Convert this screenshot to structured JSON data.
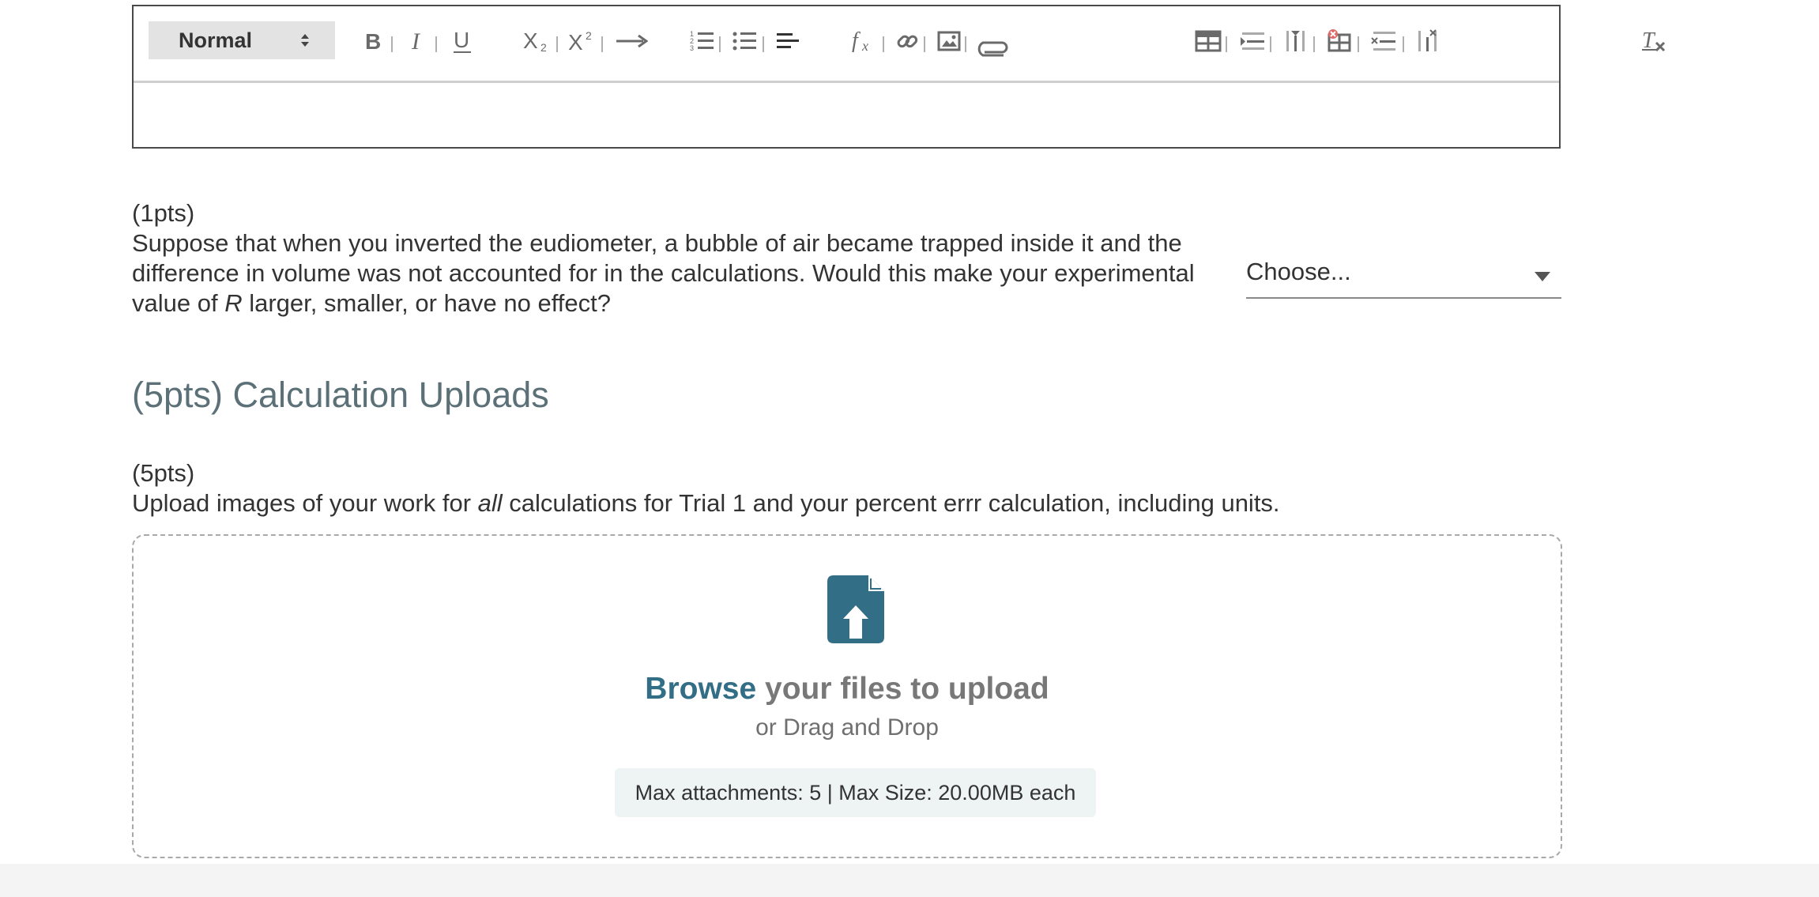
{
  "editor": {
    "style_select": {
      "value": "Normal"
    },
    "toolbar": [
      {
        "name": "bold-icon",
        "glyph": "B"
      },
      {
        "name": "italic-icon",
        "glyph": "I"
      },
      {
        "name": "underline-icon",
        "glyph": "U"
      },
      {
        "name": "subscript-icon",
        "glyph": "X2"
      },
      {
        "name": "superscript-icon",
        "glyph": "X2"
      },
      {
        "name": "arrow-icon",
        "glyph": "→"
      },
      {
        "name": "numbered-list-icon"
      },
      {
        "name": "bulleted-list-icon"
      },
      {
        "name": "align-icon"
      },
      {
        "name": "formula-icon",
        "glyph": "fx"
      },
      {
        "name": "link-icon"
      },
      {
        "name": "image-icon"
      },
      {
        "name": "attachment-icon"
      },
      {
        "name": "table-icon"
      },
      {
        "name": "insert-row-icon"
      },
      {
        "name": "insert-column-icon"
      },
      {
        "name": "delete-table-icon"
      },
      {
        "name": "delete-row-icon"
      },
      {
        "name": "delete-column-icon"
      },
      {
        "name": "clear-formatting-icon",
        "glyph": "Tx"
      }
    ]
  },
  "question1": {
    "points": "(1pts)",
    "text_before": "Suppose that when you inverted the eudiometer, a bubble of air became trapped inside it and the difference in volume was not accounted for in the calculations. Would this make your experimental value of ",
    "text_var": "R",
    "text_after": " larger, smaller, or have no effect?",
    "select_value": "Choose..."
  },
  "section": {
    "heading": "(5pts) Calculation Uploads"
  },
  "upload_question": {
    "points": "(5pts)",
    "text_before": "Upload images of your work for ",
    "text_emph": "all",
    "text_after": " calculations for Trial 1 and your percent errr calculation, including units.",
    "dropzone": {
      "browse_link": "Browse",
      "browse_rest": " your files to upload",
      "drag_text": "or Drag and Drop",
      "limits": "Max attachments: 5 | Max Size: 20.00MB each"
    }
  },
  "colors": {
    "accent": "#326e86",
    "heading": "#5c7077",
    "limits_bg": "#eef4f4",
    "toolbar_icon": "#6a6a6a"
  }
}
